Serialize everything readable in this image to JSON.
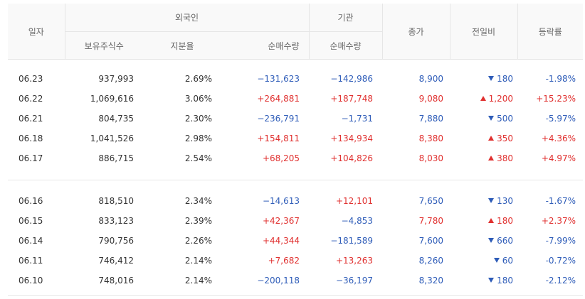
{
  "headers": {
    "date": "일자",
    "foreign": "외국인",
    "institution": "기관",
    "close": "종가",
    "change": "전일비",
    "rate": "등락률",
    "holdings": "보유주식수",
    "share": "지분율",
    "foreign_net": "순매수량",
    "inst_net": "순매수량"
  },
  "colors": {
    "up": "#e0302f",
    "down": "#2e5cb8"
  },
  "rows": [
    {
      "date": "06.23",
      "holdings": "937,993",
      "share": "2.69%",
      "foreign_net": "−131,623",
      "inst_net": "−142,986",
      "close": "8,900",
      "dir": "down",
      "change": "180",
      "rate": "-1.98%"
    },
    {
      "date": "06.22",
      "holdings": "1,069,616",
      "share": "3.06%",
      "foreign_net": "+264,881",
      "inst_net": "+187,748",
      "close": "9,080",
      "dir": "up",
      "change": "1,200",
      "rate": "+15.23%"
    },
    {
      "date": "06.21",
      "holdings": "804,735",
      "share": "2.30%",
      "foreign_net": "−236,791",
      "inst_net": "−1,731",
      "close": "7,880",
      "dir": "down",
      "change": "500",
      "rate": "-5.97%"
    },
    {
      "date": "06.18",
      "holdings": "1,041,526",
      "share": "2.98%",
      "foreign_net": "+154,811",
      "inst_net": "+134,934",
      "close": "8,380",
      "dir": "up",
      "change": "350",
      "rate": "+4.36%"
    },
    {
      "date": "06.17",
      "holdings": "886,715",
      "share": "2.54%",
      "foreign_net": "+68,205",
      "inst_net": "+104,826",
      "close": "8,030",
      "dir": "up",
      "change": "380",
      "rate": "+4.97%"
    },
    {
      "date": "06.16",
      "holdings": "818,510",
      "share": "2.34%",
      "foreign_net": "−14,613",
      "inst_net": "+12,101",
      "close": "7,650",
      "dir": "down",
      "change": "130",
      "rate": "-1.67%"
    },
    {
      "date": "06.15",
      "holdings": "833,123",
      "share": "2.39%",
      "foreign_net": "+42,367",
      "inst_net": "−4,853",
      "close": "7,780",
      "dir": "up",
      "change": "180",
      "rate": "+2.37%"
    },
    {
      "date": "06.14",
      "holdings": "790,756",
      "share": "2.26%",
      "foreign_net": "+44,344",
      "inst_net": "−181,589",
      "close": "7,600",
      "dir": "down",
      "change": "660",
      "rate": "-7.99%"
    },
    {
      "date": "06.11",
      "holdings": "746,412",
      "share": "2.14%",
      "foreign_net": "+7,682",
      "inst_net": "+13,263",
      "close": "8,260",
      "dir": "down",
      "change": "60",
      "rate": "-0.72%"
    },
    {
      "date": "06.10",
      "holdings": "748,016",
      "share": "2.14%",
      "foreign_net": "−200,118",
      "inst_net": "−36,197",
      "close": "8,320",
      "dir": "down",
      "change": "180",
      "rate": "-2.12%"
    }
  ]
}
